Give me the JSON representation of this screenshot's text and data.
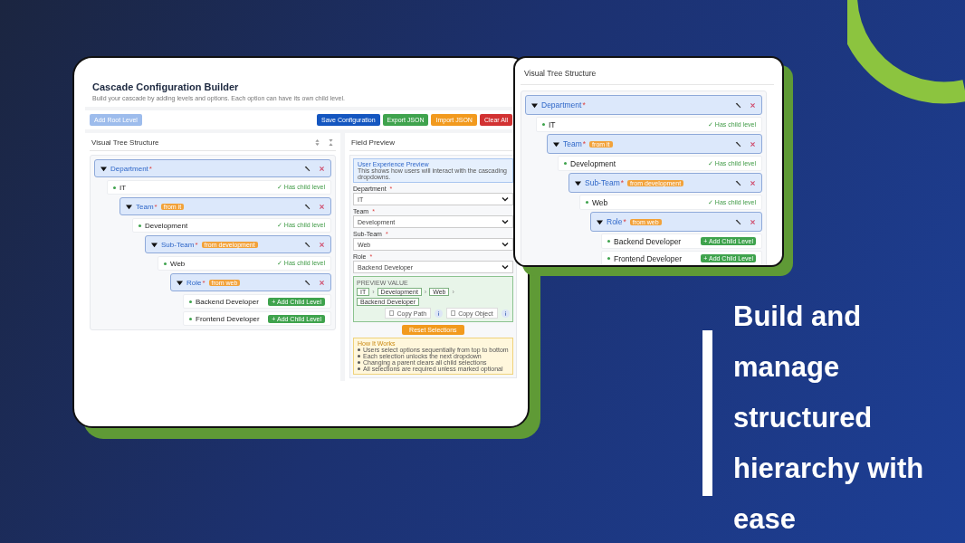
{
  "app": {
    "title": "Cascade Configuration Builder",
    "subtitle": "Build your cascade by adding levels and options. Each option can have its own child level.",
    "root_button": {
      "label": "Add Root Level",
      "disabled": true
    },
    "actions": [
      {
        "label": "Save Configuration",
        "color": "#1456c0"
      },
      {
        "label": "Export JSON",
        "color": "#3fa34d"
      },
      {
        "label": "Import JSON",
        "color": "#f29a1e"
      },
      {
        "label": "Clear All",
        "color": "#d23232"
      }
    ],
    "tree_panel": {
      "title": "Visual Tree Structure",
      "tree": [
        {
          "kind": "level",
          "label": "Department",
          "required_mark": "*",
          "children": [
            {
              "kind": "option",
              "label": "IT",
              "note": "✓ Has child level",
              "children": [
                {
                  "kind": "level",
                  "label": "Team",
                  "required_mark": "*",
                  "badge": "from it",
                  "children": [
                    {
                      "kind": "option",
                      "label": "Development",
                      "note": "✓ Has child level",
                      "children": [
                        {
                          "kind": "level",
                          "label": "Sub-Team",
                          "required_mark": "*",
                          "badge": "from development",
                          "children": [
                            {
                              "kind": "option",
                              "label": "Web",
                              "note": "✓ Has child level",
                              "children": [
                                {
                                  "kind": "level",
                                  "label": "Role",
                                  "required_mark": "*",
                                  "badge": "from web",
                                  "children": [
                                    {
                                      "kind": "option",
                                      "label": "Backend Developer",
                                      "action": "+ Add Child Level"
                                    },
                                    {
                                      "kind": "option",
                                      "label": "Frontend Developer",
                                      "action": "+ Add Child Level"
                                    }
                                  ]
                                }
                              ]
                            }
                          ]
                        }
                      ]
                    }
                  ]
                }
              ]
            }
          ]
        }
      ]
    },
    "preview_panel": {
      "title": "Field Preview",
      "info_title": "User Experience Preview",
      "info_text": "This shows how users will interact with the cascading dropdowns.",
      "fields": [
        {
          "label": "Department",
          "required_mark": "*",
          "value": "IT"
        },
        {
          "label": "Team",
          "required_mark": "*",
          "value": "Development"
        },
        {
          "label": "Sub-Team",
          "required_mark": "*",
          "value": "Web"
        },
        {
          "label": "Role",
          "required_mark": "*",
          "value": "Backend Developer"
        }
      ],
      "value_label": "PREVIEW VALUE",
      "chips": [
        "IT",
        "Development",
        "Web",
        "Backend Developer"
      ],
      "separator": "›",
      "copy_buttons": [
        "Copy Path",
        "Copy Object"
      ],
      "reset": "Reset Selections",
      "how_title": "How It Works",
      "how_items": [
        "Users select options sequentially from top to bottom",
        "Each selection unlocks the next dropdown",
        "Changing a parent clears all child selections",
        "All selections are required unless marked optional"
      ]
    }
  },
  "zoom_card": {
    "title": "Visual Tree Structure",
    "tree": [
      {
        "kind": "level",
        "label": "Department",
        "required_mark": "*",
        "children": [
          {
            "kind": "option",
            "label": "IT",
            "note": "✓ Has child level",
            "children": [
              {
                "kind": "level",
                "label": "Team",
                "required_mark": "*",
                "badge": "from it",
                "children": [
                  {
                    "kind": "option",
                    "label": "Development",
                    "note": "✓ Has child level",
                    "children": [
                      {
                        "kind": "level",
                        "label": "Sub-Team",
                        "required_mark": "*",
                        "badge": "from development",
                        "children": [
                          {
                            "kind": "option",
                            "label": "Web",
                            "note": "✓ Has child level",
                            "children": [
                              {
                                "kind": "level",
                                "label": "Role",
                                "required_mark": "*",
                                "badge": "from web",
                                "children": [
                                  {
                                    "kind": "option",
                                    "label": "Backend Developer",
                                    "action": "+ Add Child Level"
                                  },
                                  {
                                    "kind": "option",
                                    "label": "Frontend Developer",
                                    "action": "+ Add Child Level"
                                  }
                                ]
                              }
                            ]
                          }
                        ]
                      }
                    ]
                  }
                ]
              }
            ]
          }
        ]
      }
    ]
  },
  "headline": "Build and manage structured hierarchy with ease"
}
